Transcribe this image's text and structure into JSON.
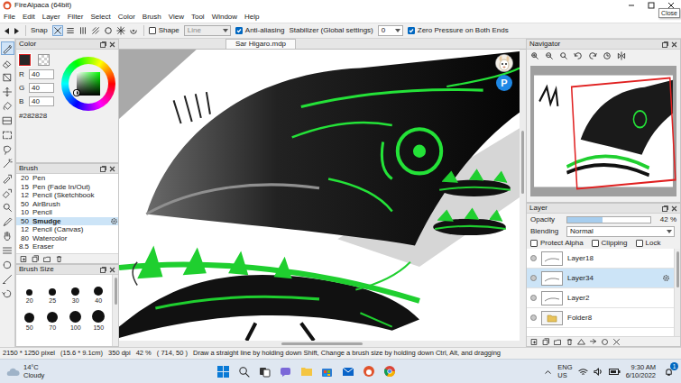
{
  "window": {
    "title": "FireAlpaca (64bit)",
    "tooltip": "Close"
  },
  "menu": [
    "File",
    "Edit",
    "Layer",
    "Filter",
    "Select",
    "Color",
    "Brush",
    "View",
    "Tool",
    "Window",
    "Help"
  ],
  "toolbar": {
    "snap_label": "Snap",
    "snap_modes": [
      {
        "selected": true
      },
      {
        "selected": false
      },
      {
        "selected": false
      },
      {
        "selected": false
      },
      {
        "selected": false
      },
      {
        "selected": false
      },
      {
        "selected": false
      }
    ],
    "shape": {
      "label": "Shape",
      "checked": false
    },
    "shape_mode": "Line",
    "anti_aliasing": {
      "label": "Anti-aliasing",
      "checked": true
    },
    "stabilizer_label": "Stabilizer (Global settings)",
    "stabilizer_value": "0",
    "zero_pressure": {
      "label": "Zero Pressure on Both Ends",
      "checked": true
    }
  },
  "tools": [
    {
      "selected": true
    },
    {
      "selected": false
    },
    {
      "selected": false
    },
    {
      "selected": false
    },
    {
      "selected": false
    },
    {
      "selected": false
    },
    {
      "selected": false
    },
    {
      "selected": false
    },
    {
      "selected": false
    },
    {
      "selected": false
    },
    {
      "selected": false
    },
    {
      "selected": false
    },
    {
      "selected": false
    },
    {
      "selected": false
    },
    {
      "selected": false
    },
    {
      "selected": false
    },
    {
      "selected": false
    },
    {
      "selected": false
    }
  ],
  "color_panel": {
    "title": "Color",
    "hex": "#282828",
    "channels": [
      {
        "label": "R",
        "value": "40"
      },
      {
        "label": "G",
        "value": "40"
      },
      {
        "label": "B",
        "value": "40"
      }
    ]
  },
  "brush_panel": {
    "title": "Brush",
    "brushes": [
      {
        "size": "20",
        "name": "Pen",
        "selected": false
      },
      {
        "size": "15",
        "name": "Pen (Fade In/Out)",
        "selected": false
      },
      {
        "size": "12",
        "name": "Pencil (Sketchbook",
        "selected": false
      },
      {
        "size": "50",
        "name": "AirBrush",
        "selected": false
      },
      {
        "size": "10",
        "name": "Pencil",
        "selected": false
      },
      {
        "size": "50",
        "name": "Smudge",
        "selected": true
      },
      {
        "size": "12",
        "name": "Pencil (Canvas)",
        "selected": false
      },
      {
        "size": "80",
        "name": "Watercolor",
        "selected": false
      },
      {
        "size": "8.5",
        "name": "Eraser",
        "selected": false
      }
    ]
  },
  "brush_size_panel": {
    "title": "Brush Size",
    "sizes": [
      "20",
      "25",
      "30",
      "40",
      "50",
      "70",
      "100",
      "150"
    ]
  },
  "canvas": {
    "tab": "Sar Higaro.mdp",
    "badge": "P"
  },
  "navigator": {
    "title": "Navigator"
  },
  "layer_panel": {
    "title": "Layer",
    "opacity_label": "Opacity",
    "opacity": "42 %",
    "opacity_level": 0.42,
    "blending_label": "Blending",
    "blending": "Normal",
    "options": [
      {
        "label": "Protect Alpha",
        "checked": false
      },
      {
        "label": "Clipping",
        "checked": false
      },
      {
        "label": "Lock",
        "checked": false
      }
    ],
    "layers": [
      {
        "name": "Layer18",
        "kind": "layer",
        "selected": false,
        "visible": true
      },
      {
        "name": "Layer34",
        "kind": "layer",
        "selected": true,
        "visible": true
      },
      {
        "name": "Layer2",
        "kind": "layer",
        "selected": false,
        "visible": true
      },
      {
        "name": "Folder8",
        "kind": "folder",
        "selected": false,
        "visible": true
      }
    ]
  },
  "status_bar": {
    "image_size": "2150 * 1250 pixel",
    "print_size": "(15.6 * 9.1cm)",
    "resolution": "350 dpi",
    "zoom": "42 %",
    "cursor": "( 714, 50 )",
    "hint": "Draw a straight line by holding down Shift, Change a brush size by holding down Ctrl, Alt, and dragging"
  },
  "taskbar": {
    "temperature": "14°C",
    "weather": "Cloudy",
    "language": "ENG",
    "region": "US",
    "time": "9:30 AM",
    "date": "6/10/2022",
    "notifications": "1"
  }
}
